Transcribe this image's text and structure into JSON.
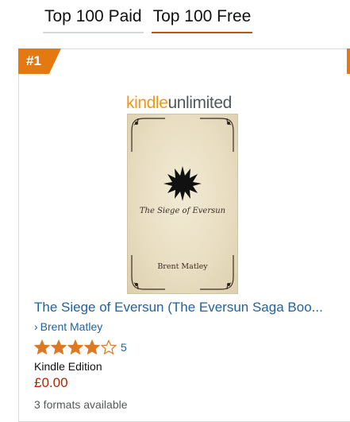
{
  "tabs": [
    {
      "label": "Top 100 Paid",
      "active": false
    },
    {
      "label": "Top 100 Free",
      "active": true
    }
  ],
  "product": {
    "rank": "#1",
    "badge": {
      "kindle": "kindle",
      "unlimited": "unlimited"
    },
    "cover": {
      "title": "The Siege of Eversun",
      "author": "Brent Matley"
    },
    "title": "The Siege of Eversun (The Eversun Saga Boo...",
    "author": "Brent Matley",
    "author_chevron": "›",
    "rating": 4,
    "rating_max": 5,
    "review_count": "5",
    "format": "Kindle Edition",
    "price": "£0.00",
    "formats_available": "3 formats available"
  },
  "colors": {
    "accent": "#e47911",
    "link": "#2162a1",
    "price": "#b12704",
    "star": "#de7921",
    "active_tab_underline": "#c45500"
  }
}
